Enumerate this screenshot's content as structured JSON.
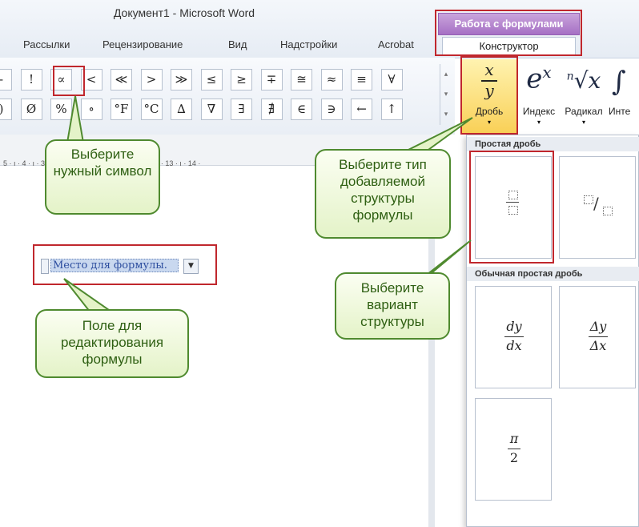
{
  "window": {
    "title": "Документ1  -  Microsoft Word"
  },
  "tabs": [
    "Рассылки",
    "Рецензирование",
    "Вид",
    "Надстройки",
    "Acrobat"
  ],
  "contextual": {
    "group_title": "Работа с формулами",
    "tab": "Конструктор"
  },
  "symbols_row1": [
    "-",
    "!",
    "∝",
    "<",
    "≪",
    ">",
    "≫",
    "≤",
    "≥",
    "∓",
    "≅",
    "≈",
    "≡",
    "∀"
  ],
  "symbols_row2": [
    ")",
    "Ø",
    "%",
    "∘",
    "°F",
    "°C",
    "∆",
    "∇",
    "∃",
    "∄",
    "∈",
    "∋",
    "←",
    "↑"
  ],
  "ruler_text": "5 · ı · 4 · ı · 3 · ı · 2 · ı · 1 · ı · 10 · ı · 11 · ı · 12 · ı · 13 · ı · 14 ·",
  "ribbon_buttons": {
    "fraction_label": "Дробь",
    "fraction_num": "x",
    "fraction_den": "y",
    "index_label": "Индекс",
    "radical_label": "Радикал",
    "integral_label": "Инте"
  },
  "equation_field": {
    "placeholder": "Место для формулы."
  },
  "fraction_gallery": {
    "section1": "Простая дробь",
    "section2": "Обычная простая дробь",
    "tiles2": [
      {
        "num": "dy",
        "den": "dx"
      },
      {
        "num": "Δy",
        "den": "Δx"
      },
      {
        "num": "π",
        "den": "2"
      }
    ]
  },
  "callouts": {
    "choose_symbol": "Выберите нужный символ",
    "choose_type": "Выберите тип добавляемой структуры формулы",
    "choose_variant": "Выберите вариант структуры",
    "edit_field": "Поле для редактирования формулы"
  }
}
